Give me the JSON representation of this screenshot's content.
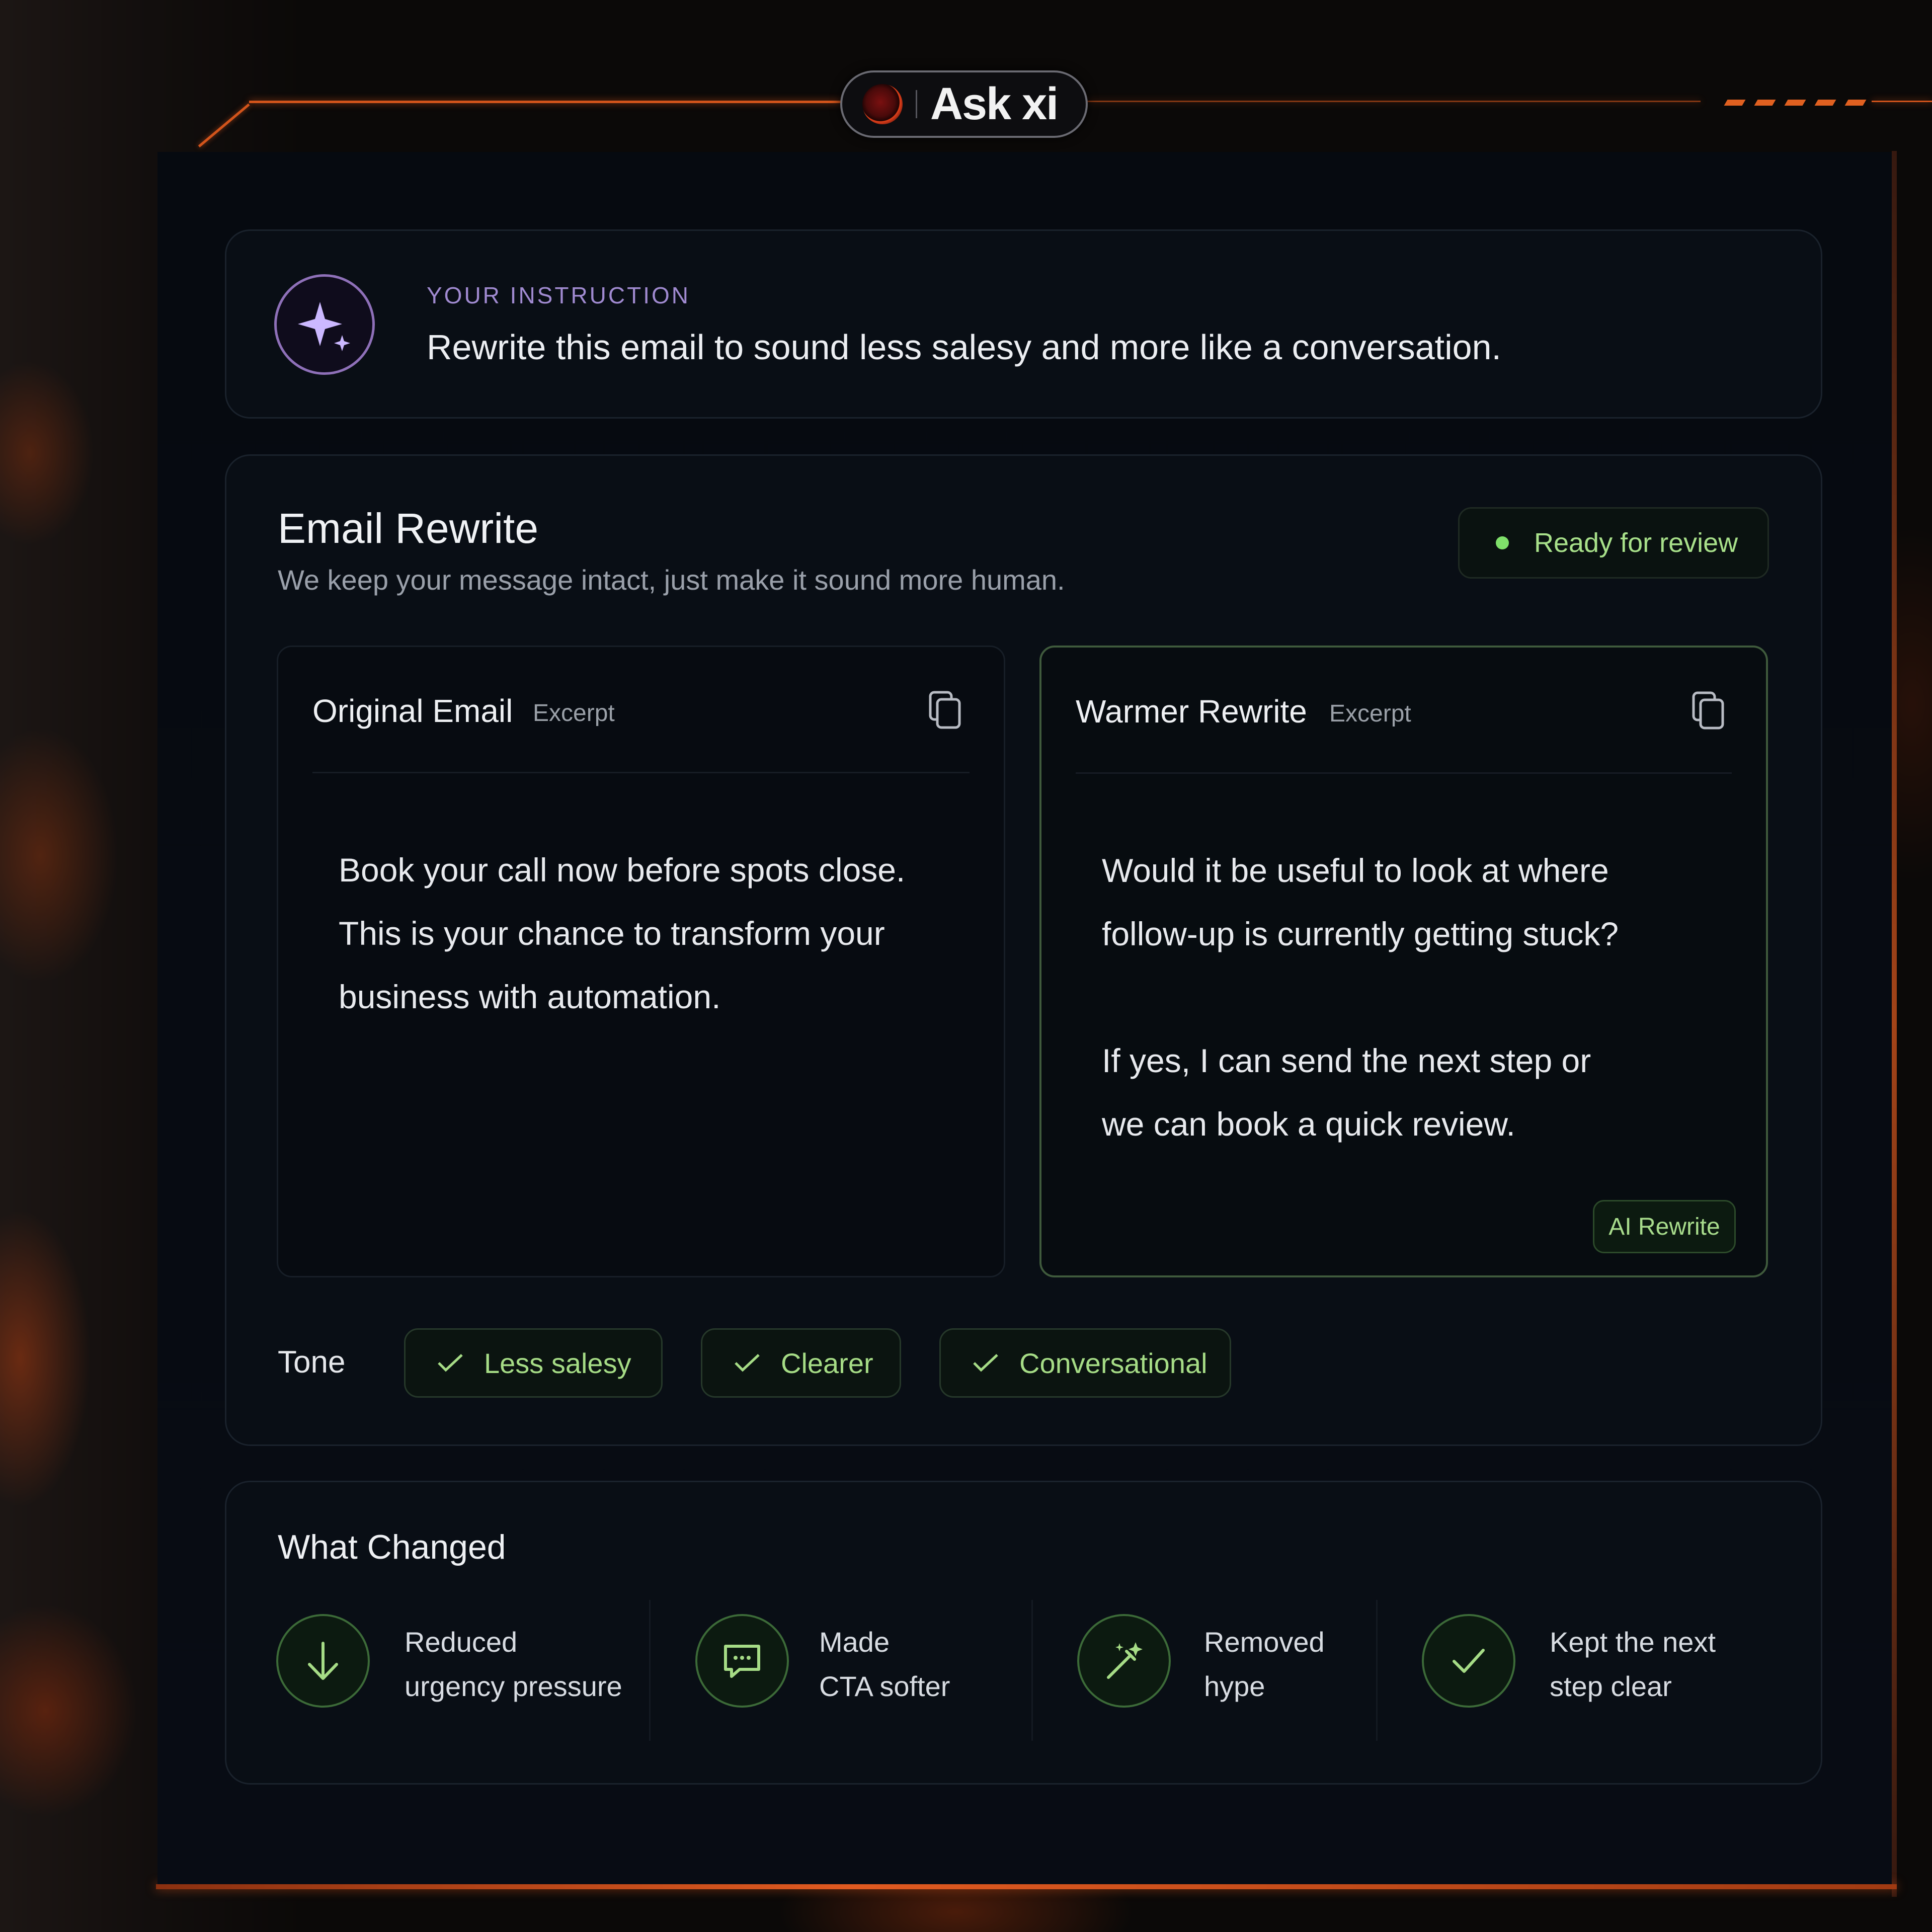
{
  "header": {
    "app_name": "Ask xi"
  },
  "instruction": {
    "eyebrow": "YOUR INSTRUCTION",
    "text": "Rewrite this email to sound less salesy and more like a conversation."
  },
  "rewrite_card": {
    "title": "Email Rewrite",
    "subtitle": "We keep your message intact, just make it sound more human.",
    "status": "Ready for review",
    "original": {
      "title": "Original Email",
      "tag": "Excerpt",
      "lines": [
        "Book your call now before spots close.",
        "This is your chance to transform your",
        "business with automation."
      ]
    },
    "rewrite": {
      "title": "Warmer Rewrite",
      "tag": "Excerpt",
      "lines": [
        "Would it be useful to look at where",
        "follow-up is currently getting stuck?",
        "",
        "If yes, I can send the next step or",
        "we can book a quick review."
      ],
      "badge": "AI Rewrite"
    },
    "tone": {
      "label": "Tone",
      "chips": [
        "Less salesy",
        "Clearer",
        "Conversational"
      ]
    }
  },
  "what_changed": {
    "title": "What Changed",
    "items": [
      {
        "icon": "arrow-down-icon",
        "line1": "Reduced",
        "line2": "urgency pressure"
      },
      {
        "icon": "chat-icon",
        "line1": "Made",
        "line2": "CTA softer"
      },
      {
        "icon": "magic-wand-icon",
        "line1": "Removed",
        "line2": "hype"
      },
      {
        "icon": "check-icon",
        "line1": "Kept the next",
        "line2": "step clear"
      }
    ]
  },
  "colors": {
    "accent_green": "#a6dc86",
    "accent_purple": "#8e70b8",
    "frame_orange": "#d2541b"
  }
}
